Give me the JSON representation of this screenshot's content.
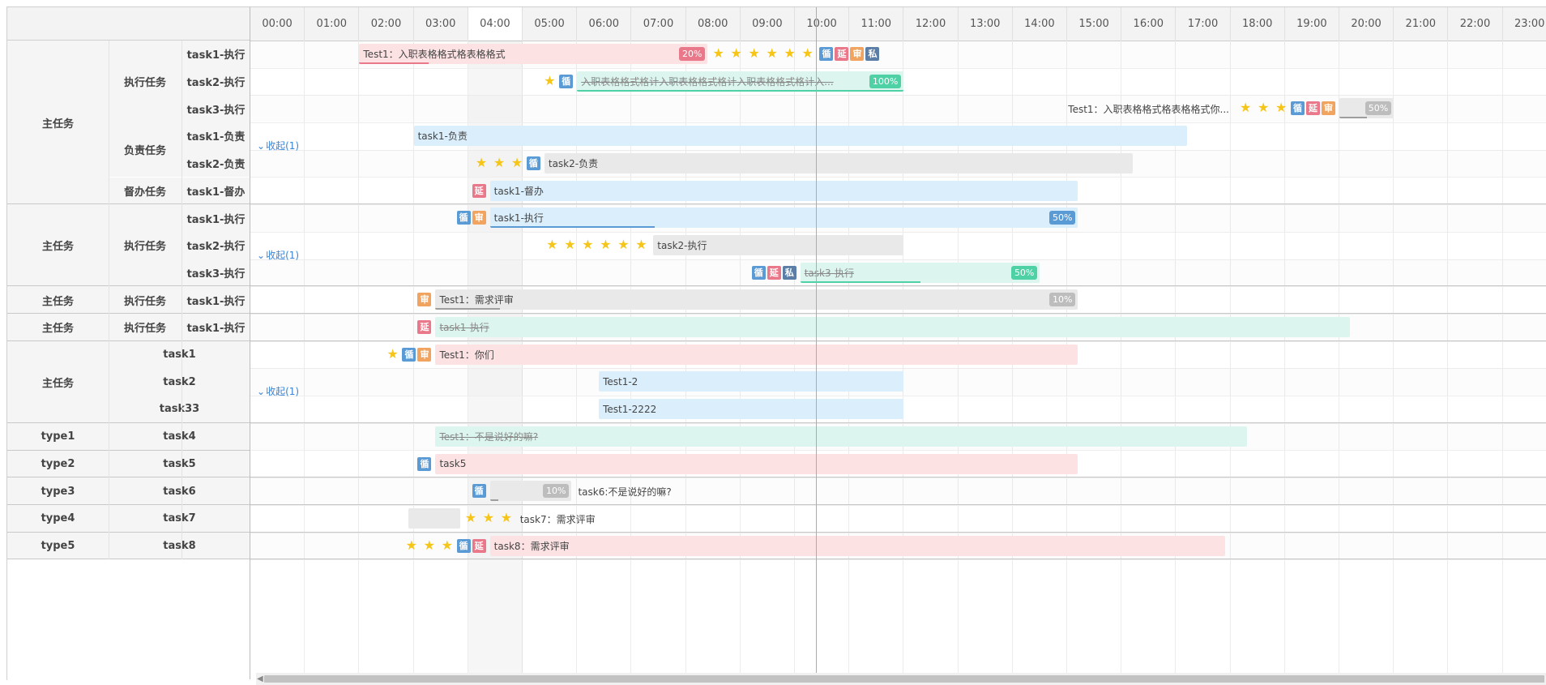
{
  "timeline": {
    "hours": [
      "00:00",
      "01:00",
      "02:00",
      "03:00",
      "04:00",
      "05:00",
      "06:00",
      "07:00",
      "08:00",
      "09:00",
      "10:00",
      "11:00",
      "12:00",
      "13:00",
      "14:00",
      "15:00",
      "16:00",
      "17:00",
      "18:00",
      "19:00",
      "20:00",
      "21:00",
      "22:00",
      "23:00"
    ],
    "highlight_hour": "04:00",
    "now_hour": 10.38
  },
  "collapse_label": "收起(1)",
  "colors": {
    "red_bar": "#fde2e4",
    "blue_bar": "#dbeefc",
    "gray_bar": "#e9e9e9",
    "green_bar": "#dcf6ef",
    "red_badge": "#e9798a",
    "orange_badge": "#f0a460",
    "blue_badge": "#5b9bd5",
    "slate_badge": "#5a7ea5",
    "star": "#f5c518",
    "now_line": "#7db8e8"
  },
  "badges": {
    "loop": "循",
    "delay": "延",
    "review": "审",
    "private": "私"
  },
  "groups": [
    {
      "label": "主任务",
      "subgroups": [
        {
          "label": "执行任务",
          "rows": [
            "task1-执行",
            "task2-执行",
            "task3-执行"
          ]
        },
        {
          "label": "负责任务",
          "rows": [
            "task1-负责",
            "task2-负责"
          ]
        },
        {
          "label": "督办任务",
          "rows": [
            "task1-督办"
          ]
        }
      ]
    },
    {
      "label": "主任务",
      "subgroups": [
        {
          "label": "执行任务",
          "rows": [
            "task1-执行",
            "task2-执行",
            "task3-执行"
          ]
        }
      ]
    },
    {
      "label": "主任务",
      "subgroups": [
        {
          "label": "执行任务",
          "rows": [
            "task1-执行"
          ]
        }
      ]
    },
    {
      "label": "主任务",
      "subgroups": [
        {
          "label": "执行任务",
          "rows": [
            "task1-执行"
          ]
        }
      ]
    },
    {
      "label": "主任务",
      "rows2": [
        "task1",
        "task2",
        "task33"
      ]
    },
    {
      "label": "type1",
      "rows2": [
        "task4"
      ]
    },
    {
      "label": "type2",
      "rows2": [
        "task5"
      ]
    },
    {
      "label": "type3",
      "rows2": [
        "task6"
      ]
    },
    {
      "label": "type4",
      "rows2": [
        "task7"
      ]
    },
    {
      "label": "type5",
      "rows2": [
        "task8"
      ]
    }
  ],
  "bars": [
    {
      "row": 0,
      "start": 2.0,
      "end": 8.4,
      "color": "red",
      "text": "Test1：入职表格格式格表格格式",
      "strike": false,
      "pct": "20%",
      "pct_color": "#e9798a",
      "prog": 0.2,
      "prog_color": "#e9798a",
      "after_stars": 6,
      "after_badges": [
        "loop",
        "delay",
        "review",
        "private"
      ]
    },
    {
      "row": 1,
      "start": 6.0,
      "end": 12.0,
      "color": "green",
      "text": "入职表格格式格计入职表格格式格计入职表格格式格计入...",
      "strike": true,
      "pct": "100%",
      "pct_color": "#4fd1a6",
      "prog": 1.0,
      "prog_color": "#4fd1a6",
      "before_stars": 1,
      "before_badges": [
        "loop"
      ]
    },
    {
      "row": 2,
      "start": 20.0,
      "end": 21.0,
      "color": "gray",
      "text": "",
      "strike": false,
      "pct": "50%",
      "pct_color": "#bdbdbd",
      "prog": 0.5,
      "prog_color": "#9e9e9e",
      "label_before": "Test1：入职表格格式格表格格式你...",
      "before_stars": 3,
      "before_badges": [
        "loop",
        "delay",
        "review"
      ]
    },
    {
      "row": 3,
      "start": 3.0,
      "end": 17.2,
      "color": "blue",
      "text": "task1-负责",
      "strike": false
    },
    {
      "row": 4,
      "start": 5.4,
      "end": 16.2,
      "color": "gray",
      "text": "task2-负责",
      "strike": false,
      "before_stars": 3,
      "before_badges": [
        "loop"
      ]
    },
    {
      "row": 5,
      "start": 4.4,
      "end": 15.2,
      "color": "blue",
      "text": "task1-督办",
      "strike": false,
      "before_badges": [
        "delay"
      ]
    },
    {
      "row": 6,
      "start": 4.4,
      "end": 15.2,
      "color": "blue",
      "text": "task1-执行",
      "strike": false,
      "pct": "50%",
      "pct_color": "#5b9bd5",
      "prog": 0.28,
      "prog_color": "#5b9bd5",
      "before_badges": [
        "loop",
        "review"
      ]
    },
    {
      "row": 7,
      "start": 7.4,
      "end": 12.0,
      "color": "gray",
      "text": "task2-执行",
      "strike": false,
      "before_stars": 6
    },
    {
      "row": 8,
      "start": 10.1,
      "end": 14.5,
      "color": "green",
      "text": "task3-执行",
      "strike": true,
      "pct": "50%",
      "pct_color": "#4fd1a6",
      "prog": 0.5,
      "prog_color": "#4fd1a6",
      "before_badges": [
        "loop",
        "delay",
        "private"
      ]
    },
    {
      "row": 9,
      "start": 3.4,
      "end": 15.2,
      "color": "gray",
      "text": "Test1：需求评审",
      "strike": false,
      "pct": "10%",
      "pct_color": "#bdbdbd",
      "prog": 0.1,
      "prog_color": "#9e9e9e",
      "before_badges": [
        "review"
      ]
    },
    {
      "row": 10,
      "start": 3.4,
      "end": 20.2,
      "color": "green",
      "text": "task1-执行",
      "strike": true,
      "before_badges": [
        "delay"
      ]
    },
    {
      "row": 11,
      "start": 3.4,
      "end": 15.2,
      "color": "red",
      "text": "Test1：你们",
      "strike": false,
      "before_stars": 1,
      "before_badges": [
        "loop",
        "review"
      ]
    },
    {
      "row": 12,
      "start": 6.4,
      "end": 12.0,
      "color": "blue",
      "text": "Test1-2",
      "strike": false
    },
    {
      "row": 13,
      "start": 6.4,
      "end": 12.0,
      "color": "blue",
      "text": "Test1-2222",
      "strike": false
    },
    {
      "row": 14,
      "start": 3.4,
      "end": 18.3,
      "color": "green",
      "text": "Test1：不是说好的嘛?",
      "strike": true
    },
    {
      "row": 15,
      "start": 3.4,
      "end": 15.2,
      "color": "red",
      "text": "task5",
      "strike": false,
      "before_badges": [
        "loop"
      ]
    },
    {
      "row": 16,
      "start": 4.4,
      "end": 5.9,
      "color": "gray",
      "text": "",
      "strike": false,
      "pct": "10%",
      "pct_color": "#bdbdbd",
      "prog": 0.1,
      "prog_color": "#9e9e9e",
      "label_after": "task6:不是说好的嘛?",
      "before_badges": [
        "loop"
      ]
    },
    {
      "row": 17,
      "start": 2.9,
      "end": 3.85,
      "color": "gray",
      "text": "",
      "strike": false,
      "after_stars": 3,
      "label_after": "task7：需求评审"
    },
    {
      "row": 18,
      "start": 4.4,
      "end": 17.9,
      "color": "red",
      "text": "task8：需求评审",
      "strike": false,
      "before_stars": 3,
      "before_badges": [
        "loop",
        "delay"
      ]
    }
  ]
}
